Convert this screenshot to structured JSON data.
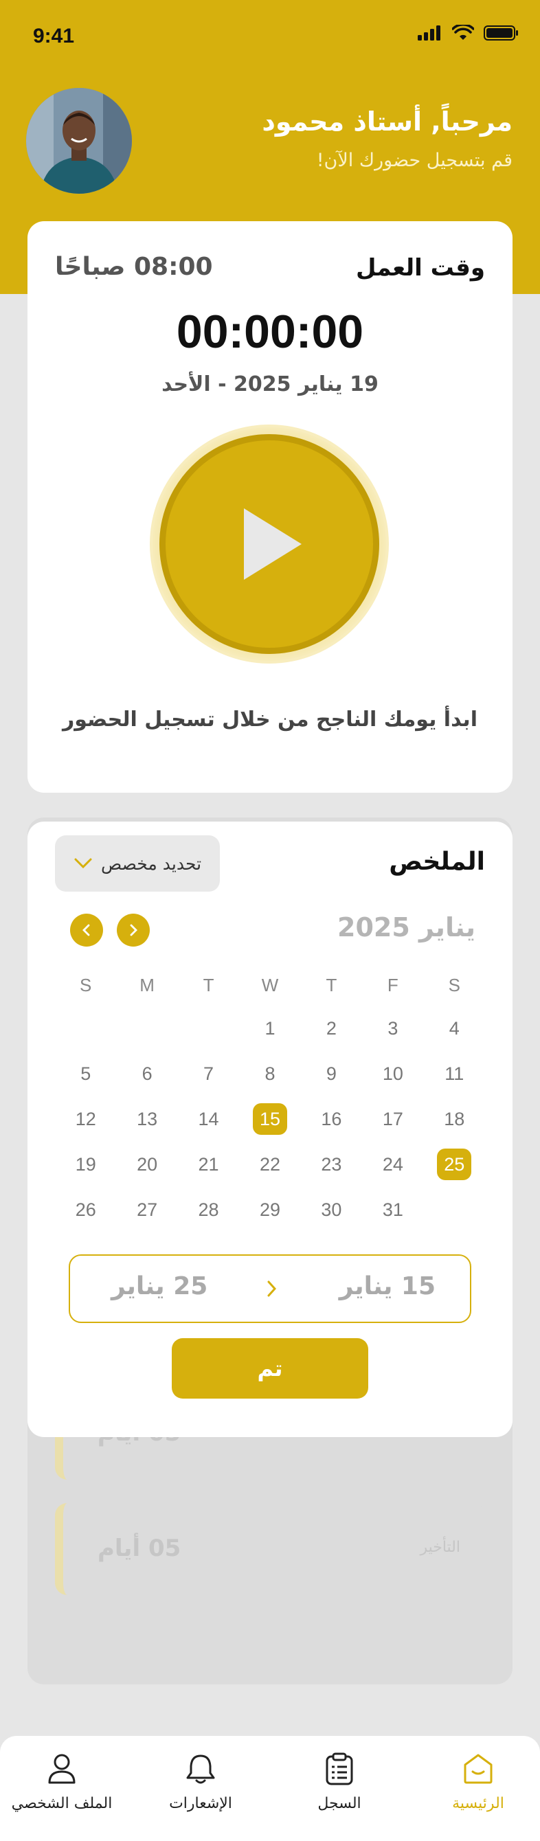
{
  "status_bar": {
    "time": "9:41"
  },
  "header": {
    "greeting": "مرحباً, أستاذ محمود",
    "subtitle": "قم بتسجيل حضورك الآن!"
  },
  "work_card": {
    "label": "وقت العمل",
    "start_time": "08:00 صباحًا",
    "timer": "00:00:00",
    "date": "19 يناير 2025 - الأحد",
    "cta": "ابدأ يومك الناجح من خلال تسجيل الحضور"
  },
  "summary": {
    "title": "الملخص",
    "range_select_label": "تحديد مخصص",
    "calendar": {
      "month_title": "يناير 2025",
      "weekdays": [
        "S",
        "M",
        "T",
        "W",
        "T",
        "F",
        "S"
      ],
      "weeks": [
        [
          "",
          "",
          "",
          "1",
          "2",
          "3",
          "4"
        ],
        [
          "5",
          "6",
          "7",
          "8",
          "9",
          "10",
          "11"
        ],
        [
          "12",
          "13",
          "14",
          "15",
          "16",
          "17",
          "18"
        ],
        [
          "19",
          "20",
          "21",
          "22",
          "23",
          "24",
          "25"
        ],
        [
          "26",
          "27",
          "28",
          "29",
          "30",
          "31",
          ""
        ]
      ],
      "selected": [
        "15",
        "25"
      ]
    },
    "range_from": "15 يناير",
    "range_to": "25 يناير",
    "done_label": "تم"
  },
  "background_items": [
    {
      "label": "",
      "value": "05 أيام"
    },
    {
      "label": "التأخير",
      "value": "05 أيام"
    }
  ],
  "bottom_nav": [
    {
      "label": "الرئيسية",
      "icon": "home-icon",
      "active": true
    },
    {
      "label": "السجل",
      "icon": "clipboard-list-icon",
      "active": false
    },
    {
      "label": "الإشعارات",
      "icon": "bell-icon",
      "active": false
    },
    {
      "label": "الملف الشخصي",
      "icon": "user-icon",
      "active": false
    }
  ],
  "colors": {
    "accent": "#d6b00d",
    "background": "#e6e6e6",
    "card": "#ffffff"
  }
}
